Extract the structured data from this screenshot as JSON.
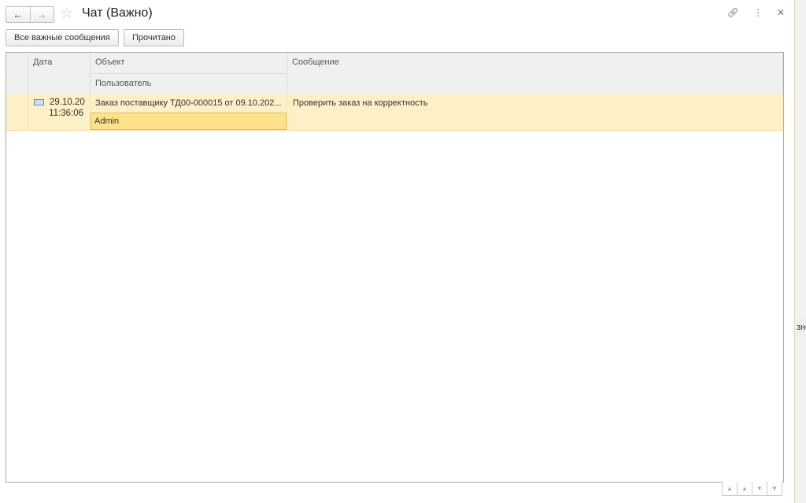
{
  "window": {
    "title": "Чат (Важно)"
  },
  "toolbar": {
    "all_important": "Все важные сообщения",
    "read": "Прочитано"
  },
  "table": {
    "headers": {
      "date": "Дата",
      "object": "Объект",
      "user": "Пользователь",
      "message": "Сообщение"
    },
    "rows": [
      {
        "date": "29.10.20",
        "time": "11:36:06",
        "object": "Заказ поставщику ТД00-000015 от 09.10.202...",
        "user": "Admin",
        "message": "Проверить заказ на корректность"
      }
    ]
  },
  "background": {
    "fragment": "зно"
  }
}
